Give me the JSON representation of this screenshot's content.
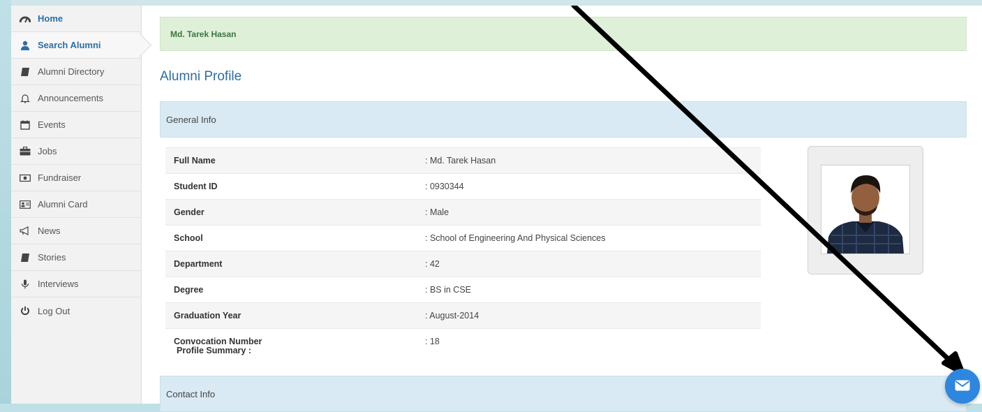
{
  "sidebar": {
    "items": [
      {
        "label": "Home",
        "icon": "dashboard-icon"
      },
      {
        "label": "Search Alumni",
        "icon": "user-icon"
      },
      {
        "label": "Alumni Directory",
        "icon": "book-icon"
      },
      {
        "label": "Announcements",
        "icon": "bell-icon"
      },
      {
        "label": "Events",
        "icon": "calendar-icon"
      },
      {
        "label": "Jobs",
        "icon": "briefcase-icon"
      },
      {
        "label": "Fundraiser",
        "icon": "money-icon"
      },
      {
        "label": "Alumni Card",
        "icon": "id-card-icon"
      },
      {
        "label": "News",
        "icon": "bullhorn-icon"
      },
      {
        "label": "Stories",
        "icon": "book-icon"
      },
      {
        "label": "Interviews",
        "icon": "microphone-icon"
      },
      {
        "label": "Log Out",
        "icon": "power-icon"
      }
    ],
    "active_index": 1
  },
  "header": {
    "user_name": "Md. Tarek Hasan"
  },
  "main": {
    "page_title": "Alumni Profile",
    "general_section": "General Info",
    "contact_section": "Contact Info",
    "profile_summary_label": "Profile Summary :",
    "rows": [
      {
        "label": "Full Name",
        "value": ": Md. Tarek Hasan"
      },
      {
        "label": "Student ID",
        "value": ": 0930344"
      },
      {
        "label": "Gender",
        "value": ": Male"
      },
      {
        "label": "School",
        "value": ": School of Engineering And Physical Sciences"
      },
      {
        "label": "Department",
        "value": ": 42"
      },
      {
        "label": "Degree",
        "value": ": BS in CSE"
      },
      {
        "label": "Graduation Year",
        "value": ": August-2014"
      },
      {
        "label": "Convocation Number",
        "value": ": 18"
      }
    ]
  },
  "colors": {
    "accent": "#2e6da4",
    "success_bg": "#dff0d8",
    "section_bg": "#d9eaf4",
    "fab": "#2e86de"
  },
  "fab": {
    "icon": "envelope-icon"
  }
}
